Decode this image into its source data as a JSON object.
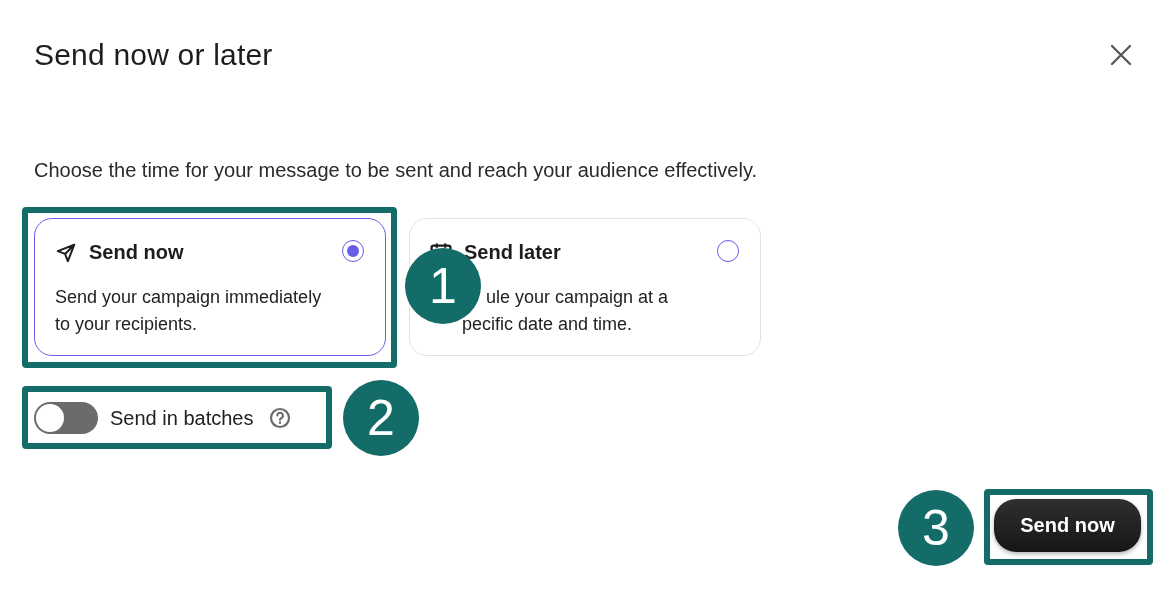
{
  "dialog": {
    "title": "Send now or later",
    "description": "Choose the time for your message to be sent and reach your audience effectively.",
    "options": [
      {
        "kind": "now",
        "title": "Send now",
        "description_lines": [
          "Send your campaign immediately",
          "to your recipients."
        ],
        "selected": true
      },
      {
        "kind": "later",
        "title": "Send later",
        "description_lines": [
          "ule your campaign at a",
          "pecific date and time."
        ],
        "selected": false
      }
    ],
    "batch_toggle": {
      "label": "Send in batches",
      "on": false
    },
    "primary_button": "Send now"
  },
  "annotations": [
    {
      "label": "1"
    },
    {
      "label": "2"
    },
    {
      "label": "3"
    }
  ]
}
